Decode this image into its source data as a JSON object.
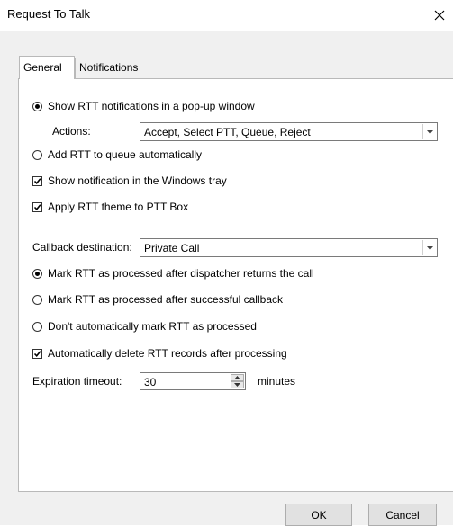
{
  "window": {
    "title": "Request To Talk"
  },
  "tabs": [
    {
      "label": "General",
      "active": true
    },
    {
      "label": "Notifications",
      "active": false
    }
  ],
  "general": {
    "show_popup_label": "Show RTT notifications in a pop-up window",
    "actions_label": "Actions:",
    "actions_value": "Accept, Select PTT, Queue, Reject",
    "add_queue_label": "Add RTT to queue automatically",
    "windows_tray_label": "Show notification in the Windows tray",
    "apply_theme_label": "Apply RTT theme to PTT Box",
    "callback_label": "Callback destination:",
    "callback_value": "Private Call",
    "mark_after_dispatcher_label": "Mark RTT as processed after dispatcher returns the call",
    "mark_after_callback_label": "Mark RTT as processed after successful callback",
    "dont_mark_label": "Don't automatically mark RTT as processed",
    "auto_delete_label": "Automatically delete RTT records after processing",
    "expiration_label": "Expiration timeout:",
    "expiration_value": "30",
    "expiration_unit": "minutes"
  },
  "state": {
    "show_popup_selected": true,
    "add_queue_selected": false,
    "windows_tray_checked": true,
    "apply_theme_checked": true,
    "mark_after_dispatcher_selected": true,
    "mark_after_callback_selected": false,
    "dont_mark_selected": false,
    "auto_delete_checked": true
  },
  "buttons": {
    "ok_label": "OK",
    "cancel_label": "Cancel"
  },
  "colors": {
    "dialog_background": "#f0f0f0",
    "panel_background": "#ffffff",
    "border": "#b9b9b9",
    "button_background": "#e1e1e1"
  },
  "icons": {
    "close": "close-icon",
    "dropdown": "chevron-down-icon",
    "spin_up": "spin-up-icon",
    "spin_down": "spin-down-icon",
    "check": "checkmark-icon"
  }
}
